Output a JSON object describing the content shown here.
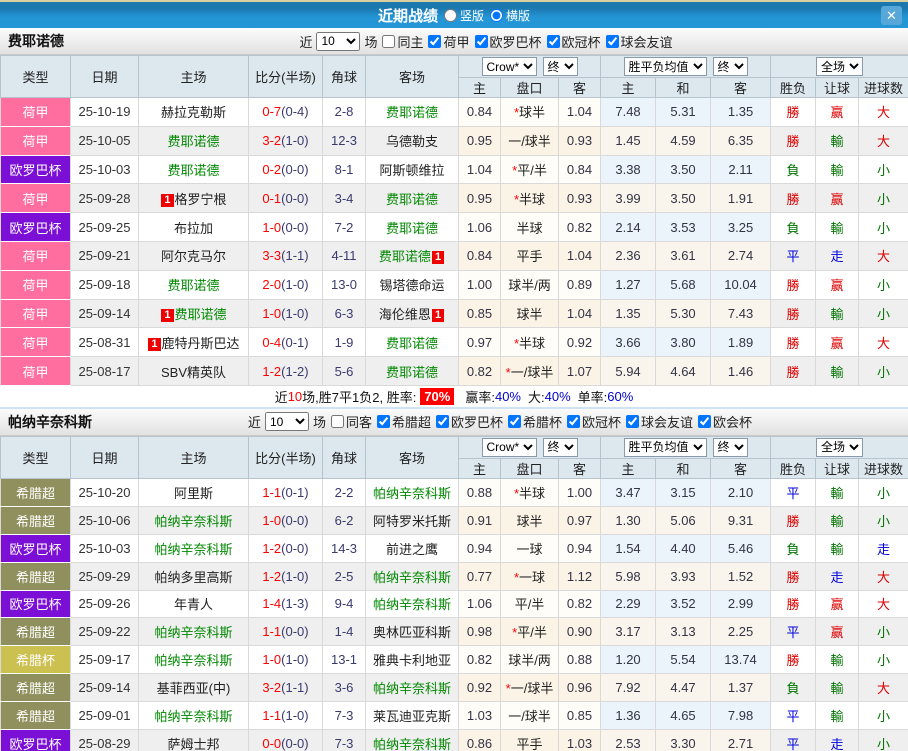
{
  "titlebar": {
    "title": "近期战绩",
    "radio_vertical": "竖版",
    "radio_horizontal": "横版",
    "close_label": "✕"
  },
  "table_header": {
    "type": "类型",
    "date": "日期",
    "home": "主场",
    "score": "比分(半场)",
    "corner": "角球",
    "away": "客场",
    "selects": {
      "odds_source": "Crow*",
      "final_a": "终",
      "avg": "胜平负均值",
      "final_b": "终",
      "scope": "全场"
    },
    "sub": [
      "主",
      "盘口",
      "客",
      "主",
      "和",
      "客",
      "胜负",
      "让球",
      "进球数"
    ]
  },
  "colors": {
    "leagues": {
      "荷甲": "#ff6e9e",
      "欧罗巴杯": "#7b0fd6",
      "希腊超": "#90905e",
      "希腊杯": "#ccc050"
    },
    "result_map": {
      "r": "#dd0000",
      "g": "#007400",
      "b": "#0000dd"
    },
    "score_full": "#ff0000",
    "score_half": "#3a3a6e",
    "subject_team": "#008800",
    "rate_badge_bg": "#ff0000",
    "percent": "#0000cc",
    "titlebar_bg": "#2496d6"
  },
  "sections": [
    {
      "team": "费耶诺德",
      "filter": {
        "near": "近",
        "count": "10",
        "games": "场",
        "same": "同主",
        "same_checked": false,
        "leagues": [
          "荷甲",
          "欧罗巴杯",
          "欧冠杯",
          "球会友谊"
        ]
      },
      "rows": [
        {
          "league": "荷甲",
          "date": "25-10-19",
          "home": "赫拉克勒斯",
          "home_subject": false,
          "home_cards": 0,
          "score": "0-7",
          "half": "(0-4)",
          "corner": "2-8",
          "away": "费耶诺德",
          "away_subject": true,
          "away_cards": 0,
          "ah": [
            "0.84",
            "球半",
            "1.04"
          ],
          "ah_star": true,
          "avg": [
            "7.48",
            "5.31",
            "1.35"
          ],
          "results": [
            [
              "勝",
              "r"
            ],
            [
              "赢",
              "r"
            ],
            [
              "大",
              "r"
            ]
          ]
        },
        {
          "league": "荷甲",
          "date": "25-10-05",
          "home": "费耶诺德",
          "home_subject": true,
          "home_cards": 0,
          "score": "3-2",
          "half": "(1-0)",
          "corner": "12-3",
          "away": "乌德勒支",
          "away_subject": false,
          "away_cards": 0,
          "ah": [
            "0.95",
            "一/球半",
            "0.93"
          ],
          "ah_star": false,
          "avg": [
            "1.45",
            "4.59",
            "6.35"
          ],
          "results": [
            [
              "勝",
              "r"
            ],
            [
              "輸",
              "g"
            ],
            [
              "大",
              "r"
            ]
          ]
        },
        {
          "league": "欧罗巴杯",
          "date": "25-10-03",
          "home": "费耶诺德",
          "home_subject": true,
          "home_cards": 0,
          "score": "0-2",
          "half": "(0-0)",
          "corner": "8-1",
          "away": "阿斯顿维拉",
          "away_subject": false,
          "away_cards": 0,
          "ah": [
            "1.04",
            "平/半",
            "0.84"
          ],
          "ah_star": true,
          "avg": [
            "3.38",
            "3.50",
            "2.11"
          ],
          "results": [
            [
              "負",
              "g"
            ],
            [
              "輸",
              "g"
            ],
            [
              "小",
              "g"
            ]
          ]
        },
        {
          "league": "荷甲",
          "date": "25-09-28",
          "home": "格罗宁根",
          "home_subject": false,
          "home_cards": 1,
          "score": "0-1",
          "half": "(0-0)",
          "corner": "3-4",
          "away": "费耶诺德",
          "away_subject": true,
          "away_cards": 0,
          "ah": [
            "0.95",
            "半球",
            "0.93"
          ],
          "ah_star": true,
          "avg": [
            "3.99",
            "3.50",
            "1.91"
          ],
          "results": [
            [
              "勝",
              "r"
            ],
            [
              "赢",
              "r"
            ],
            [
              "小",
              "g"
            ]
          ]
        },
        {
          "league": "欧罗巴杯",
          "date": "25-09-25",
          "home": "布拉加",
          "home_subject": false,
          "home_cards": 0,
          "score": "1-0",
          "half": "(0-0)",
          "corner": "7-2",
          "away": "费耶诺德",
          "away_subject": true,
          "away_cards": 0,
          "ah": [
            "1.06",
            "半球",
            "0.82"
          ],
          "ah_star": false,
          "avg": [
            "2.14",
            "3.53",
            "3.25"
          ],
          "results": [
            [
              "負",
              "g"
            ],
            [
              "輸",
              "g"
            ],
            [
              "小",
              "g"
            ]
          ]
        },
        {
          "league": "荷甲",
          "date": "25-09-21",
          "home": "阿尔克马尔",
          "home_subject": false,
          "home_cards": 0,
          "score": "3-3",
          "half": "(1-1)",
          "corner": "4-11",
          "away": "费耶诺德",
          "away_subject": true,
          "away_cards": 1,
          "ah": [
            "0.84",
            "平手",
            "1.04"
          ],
          "ah_star": false,
          "avg": [
            "2.36",
            "3.61",
            "2.74"
          ],
          "results": [
            [
              "平",
              "b"
            ],
            [
              "走",
              "b"
            ],
            [
              "大",
              "r"
            ]
          ]
        },
        {
          "league": "荷甲",
          "date": "25-09-18",
          "home": "费耶诺德",
          "home_subject": true,
          "home_cards": 0,
          "score": "2-0",
          "half": "(1-0)",
          "corner": "13-0",
          "away": "锡塔德命运",
          "away_subject": false,
          "away_cards": 0,
          "ah": [
            "1.00",
            "球半/两",
            "0.89"
          ],
          "ah_star": false,
          "avg": [
            "1.27",
            "5.68",
            "10.04"
          ],
          "results": [
            [
              "勝",
              "r"
            ],
            [
              "赢",
              "r"
            ],
            [
              "小",
              "g"
            ]
          ]
        },
        {
          "league": "荷甲",
          "date": "25-09-14",
          "home": "费耶诺德",
          "home_subject": true,
          "home_cards": 1,
          "score": "1-0",
          "half": "(1-0)",
          "corner": "6-3",
          "away": "海伦维恩",
          "away_subject": false,
          "away_cards": 1,
          "ah": [
            "0.85",
            "球半",
            "1.04"
          ],
          "ah_star": false,
          "avg": [
            "1.35",
            "5.30",
            "7.43"
          ],
          "results": [
            [
              "勝",
              "r"
            ],
            [
              "輸",
              "g"
            ],
            [
              "小",
              "g"
            ]
          ]
        },
        {
          "league": "荷甲",
          "date": "25-08-31",
          "home": "鹿特丹斯巴达",
          "home_subject": false,
          "home_cards": 1,
          "score": "0-4",
          "half": "(0-1)",
          "corner": "1-9",
          "away": "费耶诺德",
          "away_subject": true,
          "away_cards": 0,
          "ah": [
            "0.97",
            "半球",
            "0.92"
          ],
          "ah_star": true,
          "avg": [
            "3.66",
            "3.80",
            "1.89"
          ],
          "results": [
            [
              "勝",
              "r"
            ],
            [
              "赢",
              "r"
            ],
            [
              "大",
              "r"
            ]
          ]
        },
        {
          "league": "荷甲",
          "date": "25-08-17",
          "home": "SBV精英队",
          "home_subject": false,
          "home_cards": 0,
          "score": "1-2",
          "half": "(1-2)",
          "corner": "5-6",
          "away": "费耶诺德",
          "away_subject": true,
          "away_cards": 0,
          "ah": [
            "0.82",
            "一/球半",
            "1.07"
          ],
          "ah_star": true,
          "avg": [
            "5.94",
            "4.64",
            "1.46"
          ],
          "results": [
            [
              "勝",
              "r"
            ],
            [
              "輸",
              "g"
            ],
            [
              "小",
              "g"
            ]
          ]
        }
      ],
      "summary": {
        "pre": "近",
        "count": "10",
        "text": "场,胜7平1负2, 胜率:",
        "rate": "70%",
        "stats": [
          {
            "label": "赢率:",
            "value": "40%"
          },
          {
            "label": "大:",
            "value": "40%"
          },
          {
            "label": "单率:",
            "value": "60%"
          }
        ]
      }
    },
    {
      "team": "帕纳辛奈科斯",
      "filter": {
        "near": "近",
        "count": "10",
        "games": "场",
        "same": "同客",
        "same_checked": false,
        "leagues": [
          "希腊超",
          "欧罗巴杯",
          "希腊杯",
          "欧冠杯",
          "球会友谊",
          "欧会杯"
        ]
      },
      "rows": [
        {
          "league": "希腊超",
          "date": "25-10-20",
          "home": "阿里斯",
          "home_subject": false,
          "home_cards": 0,
          "score": "1-1",
          "half": "(0-1)",
          "corner": "2-2",
          "away": "帕纳辛奈科斯",
          "away_subject": true,
          "away_cards": 0,
          "ah": [
            "0.88",
            "半球",
            "1.00"
          ],
          "ah_star": true,
          "avg": [
            "3.47",
            "3.15",
            "2.10"
          ],
          "results": [
            [
              "平",
              "b"
            ],
            [
              "輸",
              "g"
            ],
            [
              "小",
              "g"
            ]
          ]
        },
        {
          "league": "希腊超",
          "date": "25-10-06",
          "home": "帕纳辛奈科斯",
          "home_subject": true,
          "home_cards": 0,
          "score": "1-0",
          "half": "(0-0)",
          "corner": "6-2",
          "away": "阿特罗米托斯",
          "away_subject": false,
          "away_cards": 0,
          "ah": [
            "0.91",
            "球半",
            "0.97"
          ],
          "ah_star": false,
          "avg": [
            "1.30",
            "5.06",
            "9.31"
          ],
          "results": [
            [
              "勝",
              "r"
            ],
            [
              "輸",
              "g"
            ],
            [
              "小",
              "g"
            ]
          ]
        },
        {
          "league": "欧罗巴杯",
          "date": "25-10-03",
          "home": "帕纳辛奈科斯",
          "home_subject": true,
          "home_cards": 0,
          "score": "1-2",
          "half": "(0-0)",
          "corner": "14-3",
          "away": "前进之鹰",
          "away_subject": false,
          "away_cards": 0,
          "ah": [
            "0.94",
            "一球",
            "0.94"
          ],
          "ah_star": false,
          "avg": [
            "1.54",
            "4.40",
            "5.46"
          ],
          "results": [
            [
              "負",
              "g"
            ],
            [
              "輸",
              "g"
            ],
            [
              "走",
              "b"
            ]
          ]
        },
        {
          "league": "希腊超",
          "date": "25-09-29",
          "home": "帕纳多里高斯",
          "home_subject": false,
          "home_cards": 0,
          "score": "1-2",
          "half": "(1-0)",
          "corner": "2-5",
          "away": "帕纳辛奈科斯",
          "away_subject": true,
          "away_cards": 0,
          "ah": [
            "0.77",
            "一球",
            "1.12"
          ],
          "ah_star": true,
          "avg": [
            "5.98",
            "3.93",
            "1.52"
          ],
          "results": [
            [
              "勝",
              "r"
            ],
            [
              "走",
              "b"
            ],
            [
              "大",
              "r"
            ]
          ]
        },
        {
          "league": "欧罗巴杯",
          "date": "25-09-26",
          "home": "年青人",
          "home_subject": false,
          "home_cards": 0,
          "score": "1-4",
          "half": "(1-3)",
          "corner": "9-4",
          "away": "帕纳辛奈科斯",
          "away_subject": true,
          "away_cards": 0,
          "ah": [
            "1.06",
            "平/半",
            "0.82"
          ],
          "ah_star": false,
          "avg": [
            "2.29",
            "3.52",
            "2.99"
          ],
          "results": [
            [
              "勝",
              "r"
            ],
            [
              "赢",
              "r"
            ],
            [
              "大",
              "r"
            ]
          ]
        },
        {
          "league": "希腊超",
          "date": "25-09-22",
          "home": "帕纳辛奈科斯",
          "home_subject": true,
          "home_cards": 0,
          "score": "1-1",
          "half": "(0-0)",
          "corner": "1-4",
          "away": "奥林匹亚科斯",
          "away_subject": false,
          "away_cards": 0,
          "ah": [
            "0.98",
            "平/半",
            "0.90"
          ],
          "ah_star": true,
          "avg": [
            "3.17",
            "3.13",
            "2.25"
          ],
          "results": [
            [
              "平",
              "b"
            ],
            [
              "赢",
              "r"
            ],
            [
              "小",
              "g"
            ]
          ]
        },
        {
          "league": "希腊杯",
          "date": "25-09-17",
          "home": "帕纳辛奈科斯",
          "home_subject": true,
          "home_cards": 0,
          "score": "1-0",
          "half": "(1-0)",
          "corner": "13-1",
          "away": "雅典卡利地亚",
          "away_subject": false,
          "away_cards": 0,
          "ah": [
            "0.82",
            "球半/两",
            "0.88"
          ],
          "ah_star": false,
          "avg": [
            "1.20",
            "5.54",
            "13.74"
          ],
          "results": [
            [
              "勝",
              "r"
            ],
            [
              "輸",
              "g"
            ],
            [
              "小",
              "g"
            ]
          ]
        },
        {
          "league": "希腊超",
          "date": "25-09-14",
          "home": "基菲西亚(中)",
          "home_subject": false,
          "home_cards": 0,
          "score": "3-2",
          "half": "(1-1)",
          "corner": "3-6",
          "away": "帕纳辛奈科斯",
          "away_subject": true,
          "away_cards": 0,
          "ah": [
            "0.92",
            "一/球半",
            "0.96"
          ],
          "ah_star": true,
          "avg": [
            "7.92",
            "4.47",
            "1.37"
          ],
          "results": [
            [
              "負",
              "g"
            ],
            [
              "輸",
              "g"
            ],
            [
              "大",
              "r"
            ]
          ]
        },
        {
          "league": "希腊超",
          "date": "25-09-01",
          "home": "帕纳辛奈科斯",
          "home_subject": true,
          "home_cards": 0,
          "score": "1-1",
          "half": "(1-0)",
          "corner": "7-3",
          "away": "莱瓦迪亚克斯",
          "away_subject": false,
          "away_cards": 0,
          "ah": [
            "1.03",
            "一/球半",
            "0.85"
          ],
          "ah_star": false,
          "avg": [
            "1.36",
            "4.65",
            "7.98"
          ],
          "results": [
            [
              "平",
              "b"
            ],
            [
              "輸",
              "g"
            ],
            [
              "小",
              "g"
            ]
          ]
        },
        {
          "league": "欧罗巴杯",
          "date": "25-08-29",
          "home": "萨姆士邦",
          "home_subject": false,
          "home_cards": 0,
          "score": "0-0",
          "half": "(0-0)",
          "corner": "7-3",
          "away": "帕纳辛奈科斯",
          "away_subject": true,
          "away_cards": 0,
          "ah": [
            "0.86",
            "平手",
            "1.03"
          ],
          "ah_star": false,
          "avg": [
            "2.53",
            "3.30",
            "2.71"
          ],
          "results": [
            [
              "平",
              "b"
            ],
            [
              "走",
              "b"
            ],
            [
              "小",
              "g"
            ]
          ]
        }
      ]
    }
  ]
}
